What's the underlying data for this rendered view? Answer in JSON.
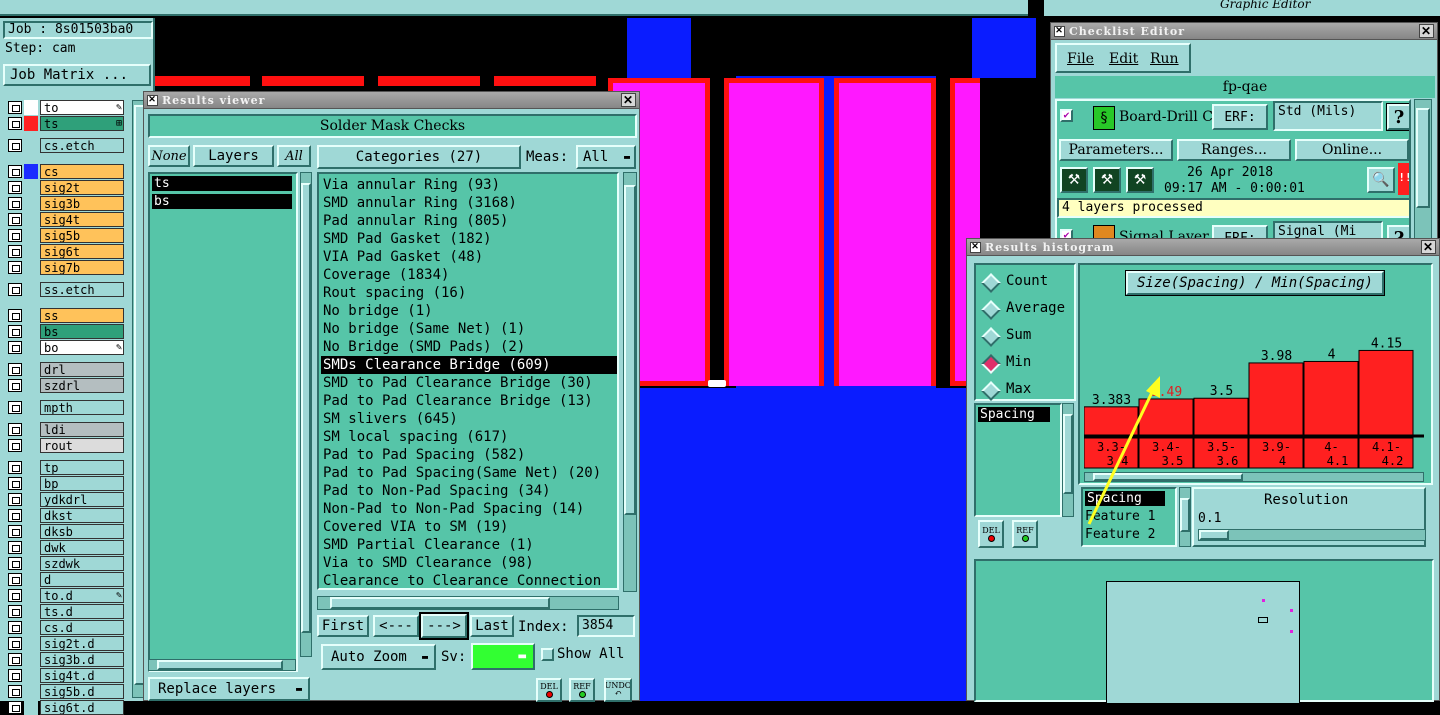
{
  "job_panel": {
    "job": "Job : 8s01503ba0",
    "step": "Step: cam",
    "matrix_button": "Job Matrix ..."
  },
  "layers": [
    {
      "name": "to",
      "color": "#ffffff",
      "bg": "#ffffff",
      "mark": "✎"
    },
    {
      "name": "ts",
      "color": "#ff2222",
      "bg": "#2fa07a",
      "mark": "⊞"
    },
    {
      "name": "cs.etch",
      "color": "#9fd8d6",
      "bg": "#9fd8d6"
    },
    {
      "name": "cs",
      "color": "#1b2cff",
      "bg": "#ffc25a"
    },
    {
      "name": "sig2t",
      "color": "#9fd8d6",
      "bg": "#ffc25a"
    },
    {
      "name": "sig3b",
      "color": "#9fd8d6",
      "bg": "#ffc25a"
    },
    {
      "name": "sig4t",
      "color": "#9fd8d6",
      "bg": "#ffc25a"
    },
    {
      "name": "sig5b",
      "color": "#9fd8d6",
      "bg": "#ffc25a"
    },
    {
      "name": "sig6t",
      "color": "#9fd8d6",
      "bg": "#ffc25a"
    },
    {
      "name": "sig7b",
      "color": "#9fd8d6",
      "bg": "#ffc25a"
    },
    {
      "name": "ss.etch",
      "color": "#9fd8d6",
      "bg": "#9fd8d6"
    },
    {
      "name": "ss",
      "color": "#9fd8d6",
      "bg": "#ffc25a"
    },
    {
      "name": "bs",
      "color": "#9fd8d6",
      "bg": "#2fa07a"
    },
    {
      "name": "bo",
      "color": "#9fd8d6",
      "bg": "#ffffff",
      "mark": "✎"
    },
    {
      "name": "drl",
      "color": "#9fd8d6",
      "bg": "#b4bec0"
    },
    {
      "name": "szdrl",
      "color": "#9fd8d6",
      "bg": "#b4bec0"
    },
    {
      "name": "mpth",
      "color": "#9fd8d6",
      "bg": "#9fd8d6"
    },
    {
      "name": "ldi",
      "color": "#9fd8d6",
      "bg": "#b4bec0"
    },
    {
      "name": "rout",
      "color": "#9fd8d6",
      "bg": "#dcdcdc"
    },
    {
      "name": "tp",
      "color": "#9fd8d6",
      "bg": "#9fd8d6"
    },
    {
      "name": "bp",
      "color": "#9fd8d6",
      "bg": "#9fd8d6"
    },
    {
      "name": "ydkdrl",
      "color": "#9fd8d6",
      "bg": "#9fd8d6"
    },
    {
      "name": "dkst",
      "color": "#9fd8d6",
      "bg": "#9fd8d6"
    },
    {
      "name": "dksb",
      "color": "#9fd8d6",
      "bg": "#9fd8d6"
    },
    {
      "name": "dwk",
      "color": "#9fd8d6",
      "bg": "#9fd8d6"
    },
    {
      "name": "szdwk",
      "color": "#9fd8d6",
      "bg": "#9fd8d6"
    },
    {
      "name": "d",
      "color": "#9fd8d6",
      "bg": "#9fd8d6"
    },
    {
      "name": "to.d",
      "color": "#9fd8d6",
      "bg": "#9fd8d6",
      "mark": "✎"
    },
    {
      "name": "ts.d",
      "color": "#9fd8d6",
      "bg": "#9fd8d6"
    },
    {
      "name": "cs.d",
      "color": "#9fd8d6",
      "bg": "#9fd8d6"
    },
    {
      "name": "sig2t.d",
      "color": "#9fd8d6",
      "bg": "#9fd8d6"
    },
    {
      "name": "sig3b.d",
      "color": "#9fd8d6",
      "bg": "#9fd8d6"
    },
    {
      "name": "sig4t.d",
      "color": "#9fd8d6",
      "bg": "#9fd8d6"
    },
    {
      "name": "sig5b.d",
      "color": "#9fd8d6",
      "bg": "#9fd8d6"
    },
    {
      "name": "sig6t.d",
      "color": "#9fd8d6",
      "bg": "#9fd8d6"
    }
  ],
  "results_viewer": {
    "title": "Results viewer",
    "heading": "Solder Mask Checks",
    "none": "None",
    "layers": "Layers",
    "all": "All",
    "layer_list": [
      "ts",
      "bs"
    ],
    "categories_label": "Categories (27)",
    "meas_label": "Meas:",
    "meas_value": "All",
    "categories": [
      "Via annular Ring (93)",
      "SMD annular Ring (3168)",
      "Pad annular Ring (805)",
      "SMD Pad Gasket (182)",
      "VIA Pad Gasket (48)",
      "Coverage (1834)",
      "Rout spacing (16)",
      "No bridge (1)",
      "No bridge (Same Net) (1)",
      "No Bridge (SMD Pads) (2)",
      "SMDs Clearance Bridge (609)",
      "SMD to Pad Clearance Bridge (30)",
      "Pad to Pad Clearance Bridge (13)",
      "SM slivers (645)",
      "SM local spacing (617)",
      "Pad to Pad Spacing (582)",
      "Pad to Pad Spacing(Same Net) (20)",
      "Pad to Non-Pad Spacing (34)",
      "Non-Pad to Non-Pad Spacing (14)",
      "Covered VIA to SM (19)",
      "SMD Partial Clearance (1)",
      "Via to SMD Clearance (98)",
      "Clearance to Clearance Connection"
    ],
    "selected_index": 10,
    "first": "First",
    "prev": "<---",
    "next": "--->",
    "last": "Last",
    "index_label": "Index:",
    "index_value": "3854",
    "auto_zoom": "Auto Zoom",
    "sv_label": "Sv:",
    "show_all": "Show All",
    "replace_layers": "Replace layers",
    "del": "DEL",
    "ref": "REF",
    "undo": "UNDO"
  },
  "top_right": {
    "subtitle": "Graphic Editor"
  },
  "checklist": {
    "title": "Checklist Editor",
    "menu": [
      "File",
      "Edit",
      "Run"
    ],
    "name": "fp-qae",
    "item1": {
      "label": "Board-Drill Che",
      "erf": "ERF:",
      "erf_value": "Std (Mils)",
      "help": "?"
    },
    "params": "Parameters...",
    "ranges": "Ranges...",
    "online": "Online...",
    "date": "26 Apr 2018",
    "time": "09:17 AM - 0:00:01",
    "status": "4 layers processed",
    "item2": {
      "label": "Signal Layer Ch",
      "erf": "ERF:",
      "erf_value": "Signal (Mi",
      "help": "?"
    }
  },
  "histogram": {
    "title": "Results histogram",
    "modes": [
      "Count",
      "Average",
      "Sum",
      "Min",
      "Max"
    ],
    "selected_mode": "Min",
    "heading": "Size(Spacing) / Min(Spacing)",
    "list_item": "Spacing",
    "fields": [
      "Spacing",
      "Feature 1",
      "Feature 2"
    ],
    "resolution_label": "Resolution",
    "resolution_value": "0.1",
    "del": "DEL",
    "ref": "REF",
    "bar_color": "#ff2020",
    "highlight_color": "#e02020"
  },
  "chart_data": {
    "type": "bar",
    "categories": [
      "3.3-3.4",
      "3.4-3.5",
      "3.5-3.6",
      "3.9-4",
      "4-4.1",
      "4.1-4.2"
    ],
    "values": [
      3.383,
      3.49,
      3.5,
      3.98,
      4,
      4.15
    ],
    "value_labels": [
      "3.383",
      "3.49",
      "3.5",
      "3.98",
      "4",
      "4.15"
    ],
    "highlighted": "3.49",
    "title": "Size(Spacing) / Min(Spacing)",
    "xlabel": "",
    "ylabel": "",
    "ylim": [
      0,
      4.5
    ]
  }
}
